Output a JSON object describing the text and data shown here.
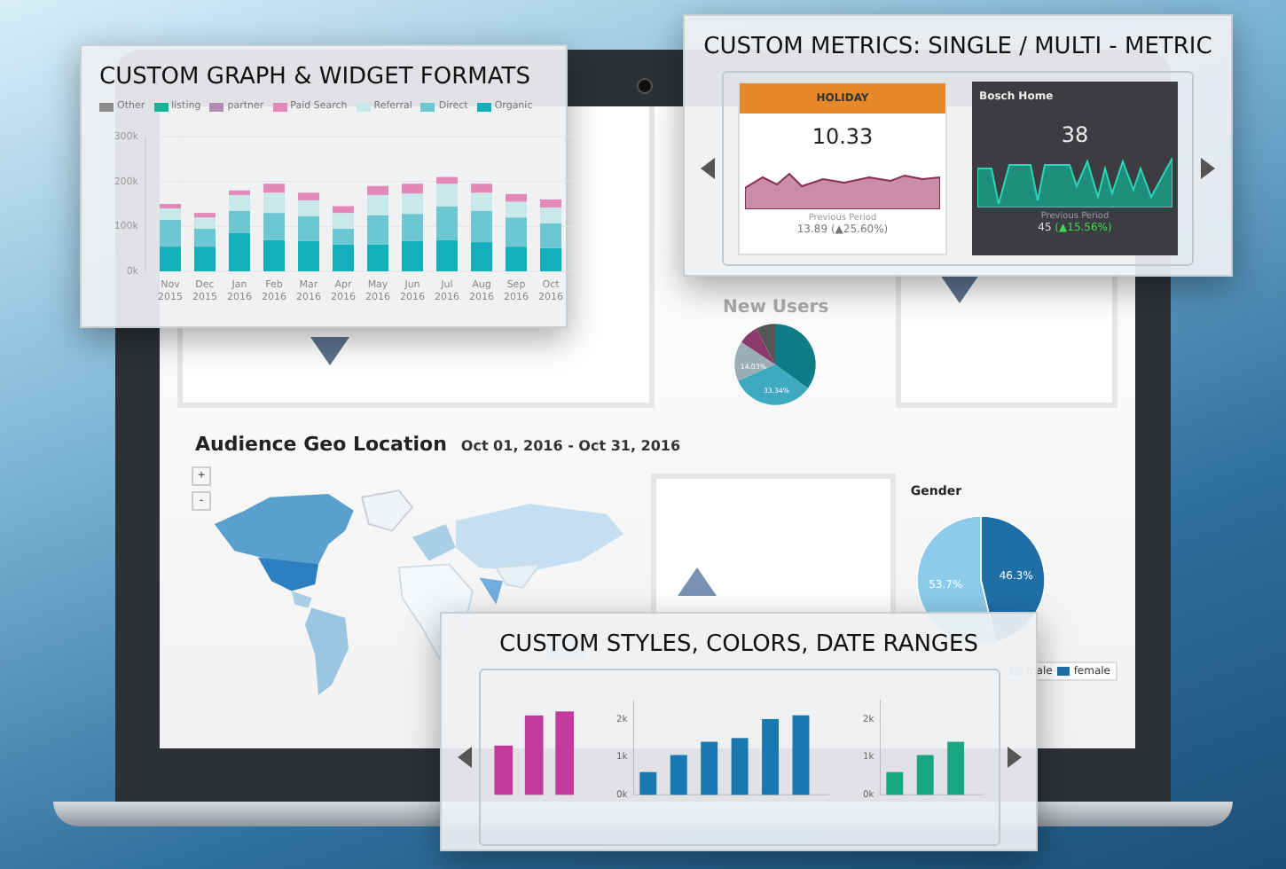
{
  "graph_panel": {
    "title": "CUSTOM GRAPH & WIDGET FORMATS",
    "chart_data": {
      "type": "bar",
      "stacked": true,
      "categories": [
        "Nov 2015",
        "Dec 2015",
        "Jan 2016",
        "Feb 2016",
        "Mar 2016",
        "Apr 2016",
        "May 2016",
        "Jun 2016",
        "Jul 2016",
        "Aug 2016",
        "Sep 2016",
        "Oct 2016"
      ],
      "ylim": [
        0,
        300
      ],
      "yticks": [
        {
          "value": 0,
          "label": "0k"
        },
        {
          "value": 100,
          "label": "100k"
        },
        {
          "value": 200,
          "label": "200k"
        },
        {
          "value": 300,
          "label": "300k"
        }
      ],
      "series": [
        {
          "name": "Paid Search",
          "color": "#e389b9",
          "values": [
            10,
            10,
            10,
            20,
            17,
            15,
            20,
            22,
            15,
            20,
            17,
            18
          ]
        },
        {
          "name": "Referral",
          "color": "#c8e8ea",
          "values": [
            25,
            25,
            35,
            45,
            35,
            35,
            45,
            45,
            50,
            40,
            35,
            35
          ]
        },
        {
          "name": "Direct",
          "color": "#6cc7d3",
          "values": [
            60,
            40,
            50,
            60,
            55,
            35,
            65,
            60,
            75,
            70,
            65,
            55
          ]
        },
        {
          "name": "Organic",
          "color": "#13b0bb",
          "values": [
            55,
            55,
            85,
            70,
            68,
            60,
            60,
            68,
            70,
            65,
            55,
            52
          ]
        }
      ]
    },
    "legend_extra": [
      {
        "label": "Other",
        "color": "#8c8c8c"
      },
      {
        "label": "listing",
        "color": "#15b39a"
      },
      {
        "label": "partner",
        "color": "#b58ab5"
      }
    ]
  },
  "metrics_panel": {
    "title": "CUSTOM METRICS: SINGLE / MULTI - METRIC",
    "widgets": [
      {
        "kind": "light",
        "header": "HOLIDAY",
        "value": "10.33",
        "caption": "Previous Period",
        "previous": "13.89",
        "change": "(▲25.60%)"
      },
      {
        "kind": "dark",
        "header": "Bosch Home",
        "value": "38",
        "caption": "Previous Period",
        "previous": "45",
        "change": "(▲15.56%)"
      }
    ]
  },
  "dashboard": {
    "new_users": "New Users",
    "pie_labels": [
      "14.03%",
      "33.34%"
    ],
    "geo": {
      "title": "Audience Geo Location",
      "date_range": "Oct 01, 2016 - Oct 31, 2016",
      "zoom": [
        "+",
        "-"
      ]
    },
    "gender": {
      "title": "Gender",
      "chart_data": {
        "type": "pie",
        "categories": [
          "male",
          "female"
        ],
        "values": [
          53.7,
          46.3
        ],
        "value_labels": [
          "53.7%",
          "46.3%"
        ]
      }
    }
  },
  "styles_panel": {
    "title": "CUSTOM STYLES, COLORS, DATE RANGES",
    "charts": [
      {
        "color": "#c33a9c"
      },
      {
        "color": "#1a78b0",
        "chart_data": {
          "type": "bar",
          "categories": [
            null,
            null,
            null,
            null,
            null,
            null
          ],
          "ylim": [
            0,
            2.5
          ],
          "yticks": [
            {
              "value": 0,
              "label": "0k"
            },
            {
              "value": 1,
              "label": "1k"
            },
            {
              "value": 2,
              "label": "2k"
            }
          ],
          "values": [
            0.6,
            1.05,
            1.4,
            1.5,
            2.0,
            2.1
          ]
        }
      },
      {
        "color": "#1aa583",
        "chart_data": {
          "type": "bar",
          "categories": [
            null,
            null,
            null
          ],
          "ylim": [
            0,
            2.5
          ],
          "yticks": [
            {
              "value": 0,
              "label": "0k"
            },
            {
              "value": 1,
              "label": "1k"
            },
            {
              "value": 2,
              "label": "2k"
            }
          ],
          "values": [
            0.6,
            1.05,
            1.4
          ]
        }
      }
    ]
  }
}
